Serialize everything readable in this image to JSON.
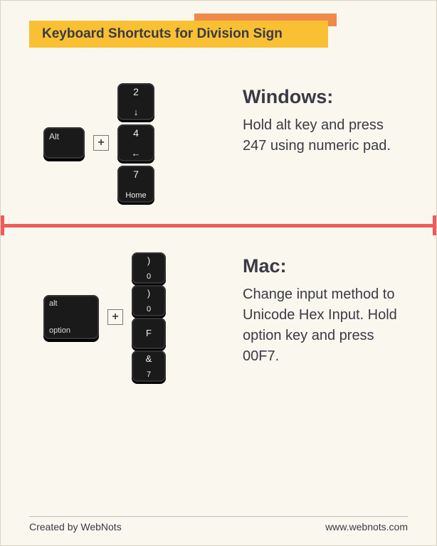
{
  "title": "Keyboard Shortcuts for Division Sign",
  "windows": {
    "heading": "Windows:",
    "body": "Hold alt key and press 247 using numeric pad.",
    "mod_key": "Alt",
    "plus": "+",
    "keys": [
      {
        "top": "2",
        "bot_glyph": "↓"
      },
      {
        "top": "4",
        "bot_glyph": "←"
      },
      {
        "top": "7",
        "bot_text": "Home"
      }
    ]
  },
  "mac": {
    "heading": "Mac:",
    "body": "Change input method to Unicode Hex Input. Hold option key and press 00F7.",
    "mod_key_top": "alt",
    "mod_key_bot": "option",
    "plus": "+",
    "keys": [
      {
        "top": ")",
        "bot": "0"
      },
      {
        "top": ")",
        "bot": "0"
      },
      {
        "top": "F",
        "bot": ""
      },
      {
        "top": "&",
        "bot": "7"
      }
    ]
  },
  "footer": {
    "left": "Created by WebNots",
    "right": "www.webnots.com"
  }
}
